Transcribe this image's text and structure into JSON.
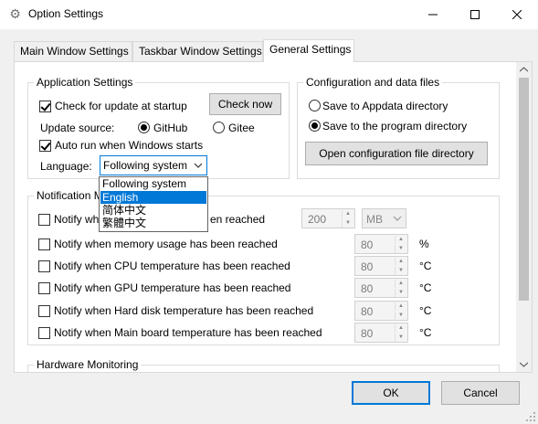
{
  "window": {
    "title": "Option Settings",
    "app_icon": "gear-icon",
    "minimize_icon": "minimize-icon",
    "maximize_icon": "maximize-icon",
    "close_icon": "close-icon"
  },
  "tabs": [
    {
      "label": "Main Window Settings",
      "active": false
    },
    {
      "label": "Taskbar Window Settings",
      "active": false
    },
    {
      "label": "General Settings",
      "active": true
    }
  ],
  "app_settings": {
    "title": "Application Settings",
    "check_update_label": "Check for update at startup",
    "check_update_checked": true,
    "check_now_label": "Check now",
    "update_source_label": "Update source:",
    "source_github_label": "GitHub",
    "source_gitee_label": "Gitee",
    "selected_source": "GitHub",
    "auto_run_label": "Auto run when Windows starts",
    "auto_run_checked": true,
    "language_label": "Language:",
    "language_value": "Following system",
    "language_options": [
      "Following system",
      "English",
      "简体中文",
      "繁體中文"
    ],
    "language_highlighted": "English"
  },
  "config_files": {
    "title": "Configuration and data files",
    "appdata_label": "Save to Appdata directory",
    "program_dir_label": "Save to the program directory",
    "selected": "Save to the program directory",
    "open_dir_label": "Open configuration file directory"
  },
  "notification": {
    "title_visible": "Notification M",
    "rows": [
      {
        "label_left": "Notify whe",
        "label_right": "en reached",
        "value": "200",
        "unit": "MB",
        "checked": false
      },
      {
        "label": "Notify when memory usage has been reached",
        "value": "80",
        "unit": "%",
        "checked": false
      },
      {
        "label": "Notify when CPU temperature has been reached",
        "value": "80",
        "unit": "°C",
        "checked": false
      },
      {
        "label": "Notify when GPU temperature has been reached",
        "value": "80",
        "unit": "°C",
        "checked": false
      },
      {
        "label": "Notify when Hard disk temperature has been reached",
        "value": "80",
        "unit": "°C",
        "checked": false
      },
      {
        "label": "Notify when Main board temperature has been reached",
        "value": "80",
        "unit": "°C",
        "checked": false
      }
    ]
  },
  "hardware": {
    "title": "Hardware Monitoring"
  },
  "footer": {
    "ok_label": "OK",
    "cancel_label": "Cancel"
  },
  "colors": {
    "accent": "#0078d7",
    "button_bg": "#e1e1e1",
    "window_bg": "#f0f0f0"
  }
}
